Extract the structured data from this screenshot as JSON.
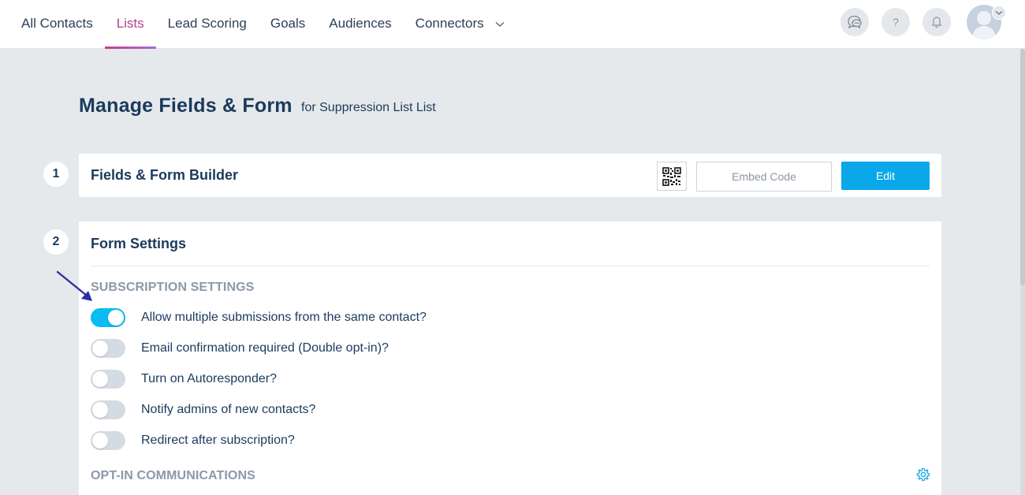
{
  "nav": {
    "items": [
      {
        "label": "All Contacts",
        "active": false
      },
      {
        "label": "Lists",
        "active": true
      },
      {
        "label": "Lead Scoring",
        "active": false
      },
      {
        "label": "Goals",
        "active": false
      },
      {
        "label": "Audiences",
        "active": false
      },
      {
        "label": "Connectors",
        "active": false,
        "has_dropdown": true
      }
    ],
    "right_icons": [
      "chat-bubbles-icon",
      "help-icon",
      "bell-icon",
      "avatar"
    ],
    "help_glyph": "?"
  },
  "page": {
    "title": "Manage Fields & Form",
    "subtitle": "for Suppression List List"
  },
  "steps": {
    "one": {
      "number": "1",
      "title": "Fields & Form Builder",
      "embed_label": "Embed Code",
      "edit_label": "Edit"
    },
    "two": {
      "number": "2",
      "title": "Form Settings",
      "subscription_heading": "SUBSCRIPTION SETTINGS",
      "toggles": [
        {
          "label": "Allow multiple submissions from the same contact?",
          "on": true
        },
        {
          "label": "Email confirmation required (Double opt-in)?",
          "on": false
        },
        {
          "label": "Turn on Autoresponder?",
          "on": false
        },
        {
          "label": "Notify admins of new contacts?",
          "on": false
        },
        {
          "label": "Redirect after subscription?",
          "on": false
        }
      ],
      "optin_heading": "OPT-IN COMMUNICATIONS"
    }
  },
  "colors": {
    "accent_blue": "#0aa8e8",
    "active_nav": "#b7408e",
    "toggle_on": "#0bbcf2",
    "annotation_arrow": "#2a2fa8"
  }
}
